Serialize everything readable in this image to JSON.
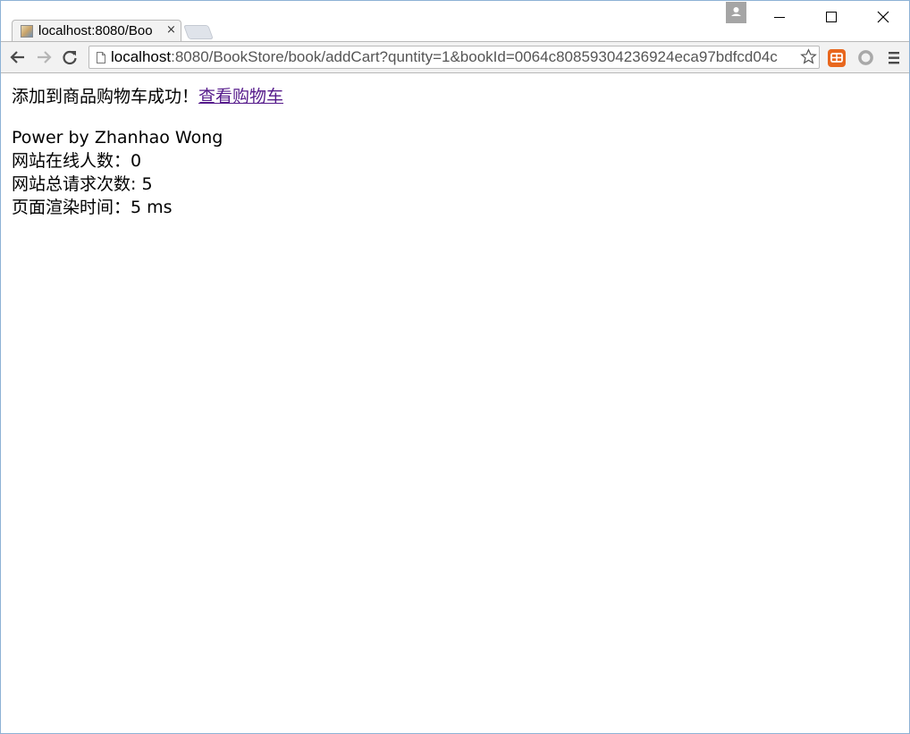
{
  "browser": {
    "tab": {
      "title": "localhost:8080/Boo",
      "close_glyph": "×"
    },
    "url": {
      "host": "localhost",
      "rest": ":8080/BookStore/book/addCart?quntity=1&bookId=0064c80859304236924eca97bdfcd04c"
    },
    "icons": {
      "favicon": "book-favicon-icon",
      "back": "back-arrow-icon",
      "forward": "forward-arrow-icon",
      "reload": "reload-icon",
      "page": "page-icon",
      "bookmark": "star-icon",
      "ext1": "extension-icon",
      "ext2": "circle-extension-icon",
      "menu": "menu-icon",
      "profile": "profile-icon"
    },
    "colors": {
      "ext1": "#e8671e",
      "link_visited": "#551a8b"
    }
  },
  "page": {
    "message": "添加到商品购物车成功！",
    "cart_link": "查看购物车",
    "footer": {
      "power": "Power by Zhanhao Wong",
      "online_users": "网站在线人数：0",
      "total_requests": "网站总请求次数: 5",
      "render_time": "页面渲染时间：5 ms"
    }
  }
}
